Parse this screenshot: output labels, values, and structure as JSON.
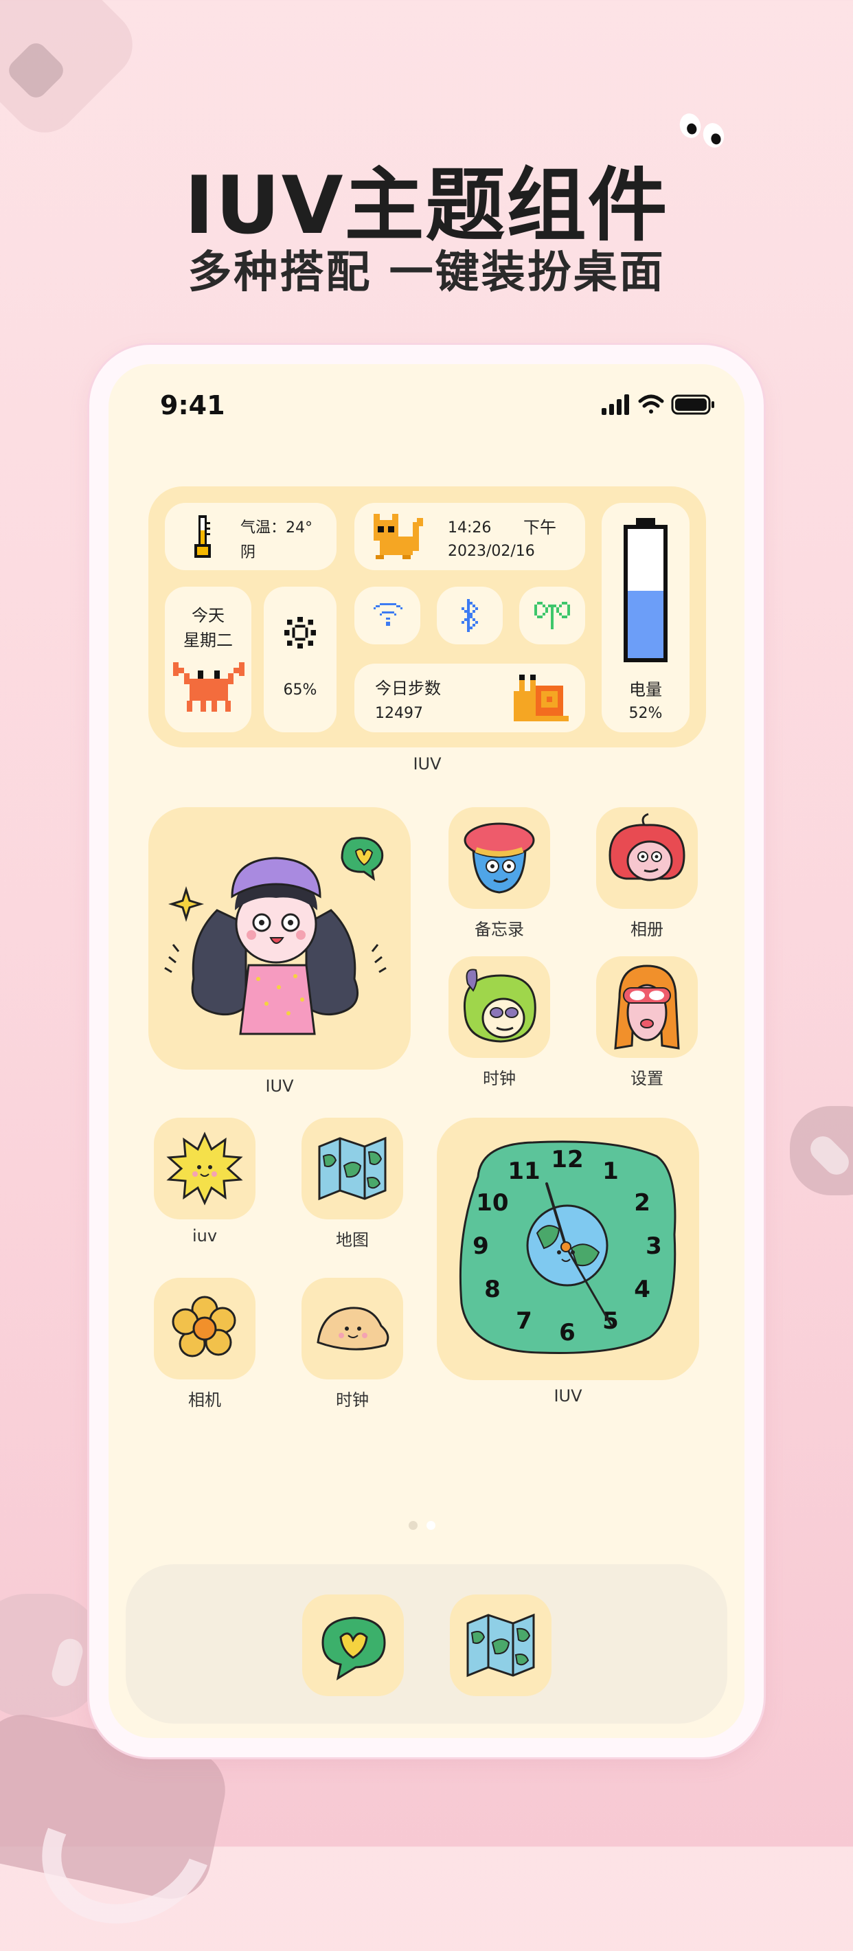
{
  "promo": {
    "title": "IUV主题组件",
    "subtitle": "多种搭配 一键装扮桌面"
  },
  "status_bar": {
    "time": "9:41",
    "icons": [
      "cellular-signal-icon",
      "wifi-icon",
      "battery-icon"
    ]
  },
  "info_widget": {
    "temperature_label": "气温：24°",
    "weather": "阴",
    "clock_time": "14:26",
    "clock_period": "下午",
    "clock_date": "2023/02/16",
    "today_label": "今天",
    "weekday": "星期二",
    "brightness_value": "65%",
    "toggles": [
      "wifi-icon",
      "bluetooth-icon",
      "cellular-icon"
    ],
    "steps_label": "今日步数",
    "steps_value": "12497",
    "battery_label": "电量",
    "battery_value": "52%",
    "battery_level": 0.52,
    "caption": "IUV"
  },
  "photo_widget": {
    "caption": "IUV"
  },
  "apps_top": [
    {
      "label": "备忘录",
      "icon": "beret-face-icon"
    },
    {
      "label": "相册",
      "icon": "red-hair-face-icon"
    },
    {
      "label": "时钟",
      "icon": "green-hair-face-icon"
    },
    {
      "label": "设置",
      "icon": "goggles-face-icon"
    }
  ],
  "apps_bottom": [
    {
      "label": "iuv",
      "icon": "sun-face-icon"
    },
    {
      "label": "地图",
      "icon": "map-icon"
    },
    {
      "label": "相机",
      "icon": "flower-icon"
    },
    {
      "label": "时钟",
      "icon": "dumpling-icon"
    }
  ],
  "clock_widget": {
    "caption": "IUV",
    "numbers": [
      "12",
      "1",
      "2",
      "3",
      "4",
      "5",
      "6",
      "7",
      "8",
      "9",
      "10",
      "11"
    ]
  },
  "pager": {
    "pages": 2,
    "active": 1
  },
  "dock": {
    "apps": [
      "chat-bubble-icon",
      "map-icon"
    ]
  },
  "colors": {
    "widget_bg": "#fde9b9",
    "screen_bg": "#fff7e4",
    "clock_face": "#5cc49a",
    "battery_fill": "#6c9ef8"
  }
}
